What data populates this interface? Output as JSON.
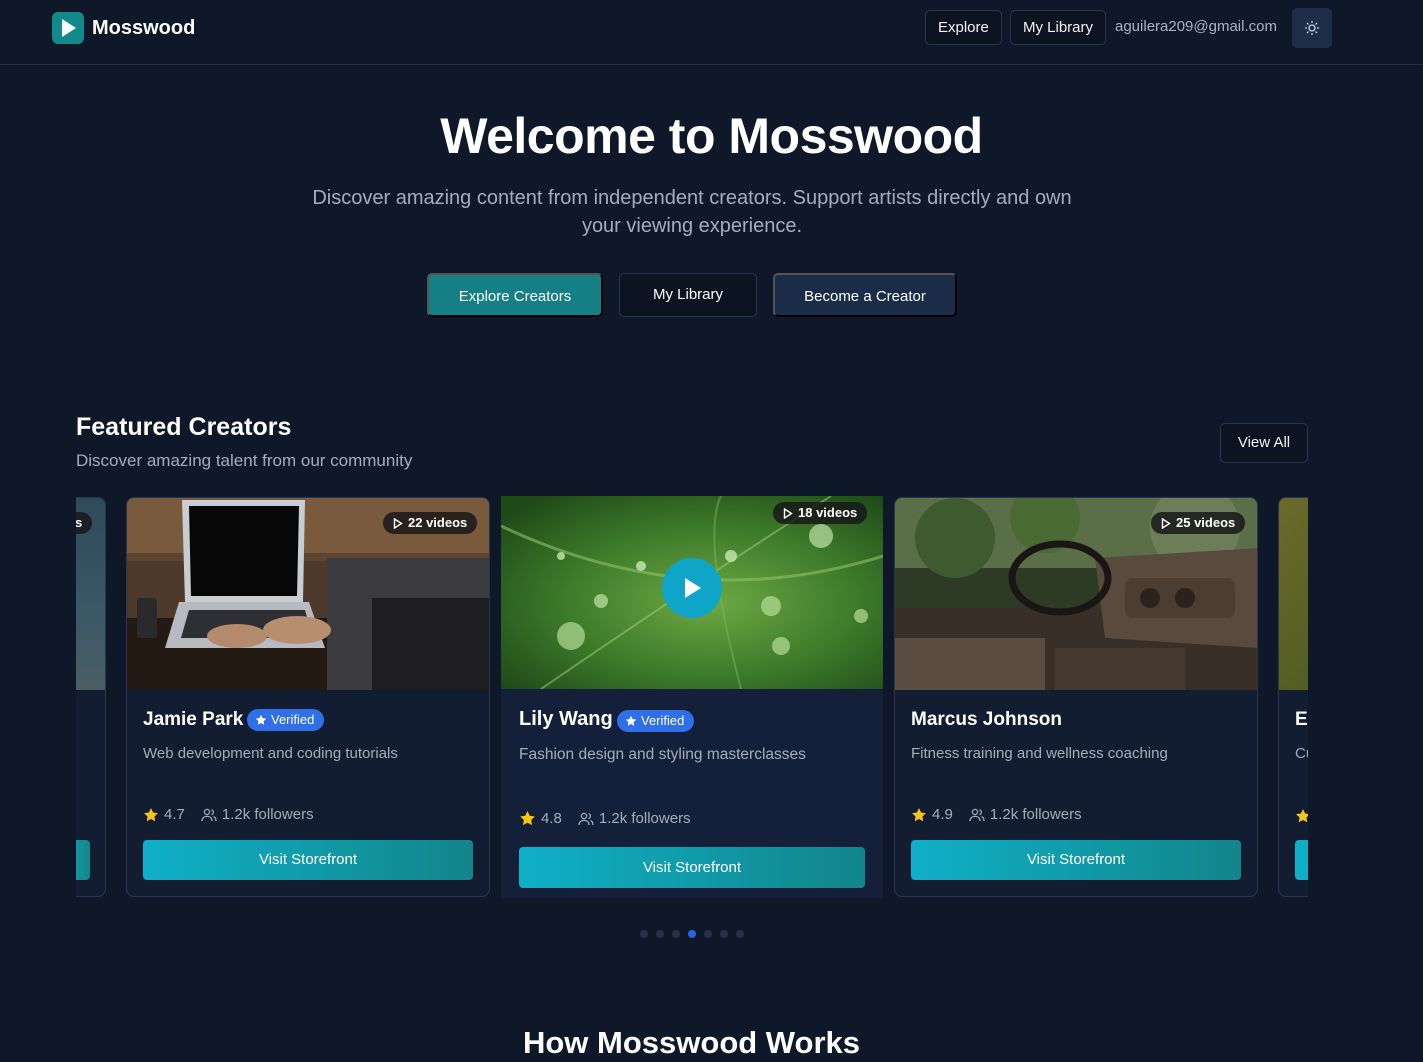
{
  "header": {
    "app_name": "Mosswood",
    "nav": {
      "explore": "Explore",
      "library": "My Library"
    },
    "email": "aguilera209@gmail.com",
    "theme_icon": "sun-icon"
  },
  "hero": {
    "title": "Welcome to Mosswood",
    "subtitle": "Discover amazing content from independent creators. Support artists directly and own your viewing experience.",
    "buttons": {
      "explore": "Explore Creators",
      "library": "My Library",
      "creator": "Become a Creator"
    }
  },
  "featured": {
    "title": "Featured Creators",
    "subtitle": "Discover amazing talent from our community",
    "view_all": "View All",
    "cards": [
      {
        "name": "",
        "videos": "s",
        "desc": ""
      },
      {
        "name": "Jamie Park",
        "verified": "Verified",
        "videos": "22 videos",
        "desc": "Web development and coding tutorials",
        "rating": "4.7",
        "followers": "1.2k followers",
        "cta": "Visit Storefront"
      },
      {
        "name": "Lily Wang",
        "verified": "Verified",
        "videos": "18 videos",
        "desc": "Fashion design and styling masterclasses",
        "rating": "4.8",
        "followers": "1.2k followers",
        "cta": "Visit Storefront"
      },
      {
        "name": "Marcus Johnson",
        "videos": "25 videos",
        "desc": "Fitness training and wellness coaching",
        "rating": "4.9",
        "followers": "1.2k followers",
        "cta": "Visit Storefront"
      },
      {
        "name": "El",
        "desc": "Cu"
      }
    ],
    "carousel": {
      "total_slides": 7,
      "active_slide": 4
    }
  },
  "how": {
    "title": "How Mosswood Works"
  },
  "colors": {
    "background": "#0f1828",
    "accent": "#157f86",
    "verified": "#2f6fe8",
    "active_dot": "#2563eb"
  }
}
